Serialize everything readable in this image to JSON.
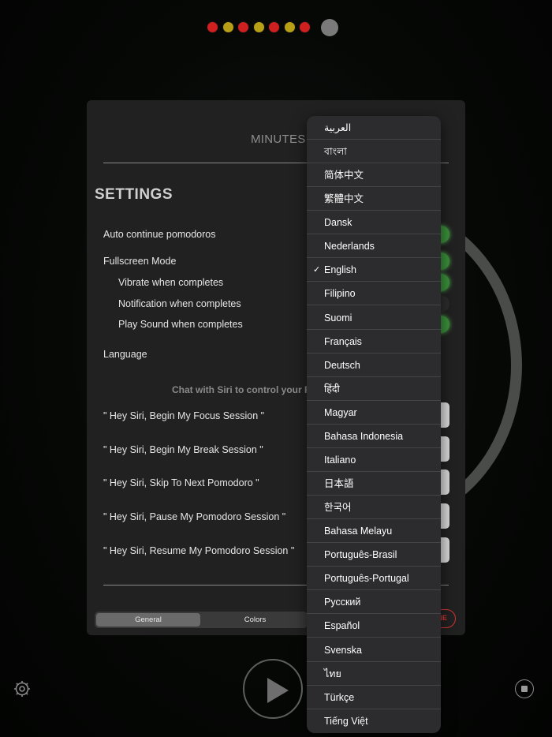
{
  "pomodoro_dots": {
    "colors": [
      "#d01f1f",
      "#b8a016",
      "#d01f1f",
      "#b8a016",
      "#d01f1f",
      "#b8a016",
      "#d01f1f"
    ],
    "current_color": "#7a7a7a"
  },
  "header": {
    "minutes_label": "MINUTES"
  },
  "settings": {
    "title": "SETTINGS",
    "rows": {
      "auto_continue": "Auto continue pomodoros",
      "fullscreen": "Fullscreen Mode",
      "vibrate": "Vibrate when completes",
      "notification": "Notification when completes",
      "play_sound": "Play Sound when completes",
      "language": "Language"
    },
    "toggles": {
      "auto_continue": true,
      "fullscreen": true,
      "vibrate": true,
      "notification": false,
      "play_sound": true
    },
    "siri_hint": "Chat with Siri to control your Po",
    "siri_phrases": [
      "\" Hey Siri, Begin My Focus Session \"",
      "\" Hey Siri, Begin My Break Session \"",
      "\" Hey Siri, Skip To Next Pomodoro \"",
      "\" Hey Siri, Pause My Pomodoro Session \"",
      "\" Hey Siri, Resume My Pomodoro Session \""
    ],
    "tabs": [
      "General",
      "Colors"
    ],
    "active_tab": "General",
    "done_label": "NE"
  },
  "language_menu": {
    "selected": "English",
    "items": [
      "العربية",
      "বাংলা",
      "简体中文",
      "繁體中文",
      "Dansk",
      "Nederlands",
      "English",
      "Filipino",
      "Suomi",
      "Français",
      "Deutsch",
      "हिंदी",
      "Magyar",
      "Bahasa Indonesia",
      "Italiano",
      "日本語",
      "한국어",
      "Bahasa Melayu",
      "Português-Brasil",
      "Português-Portugal",
      "Русский",
      "Español",
      "Svenska",
      "ไทย",
      "Türkçe",
      "Tiếng Việt"
    ],
    "check_glyph": "✓"
  },
  "colors": {
    "accent_green": "#3a8f3a",
    "done_red": "#d63333"
  },
  "icons": {
    "settings": "gear-icon",
    "play": "play-icon",
    "stop": "stop-icon"
  }
}
